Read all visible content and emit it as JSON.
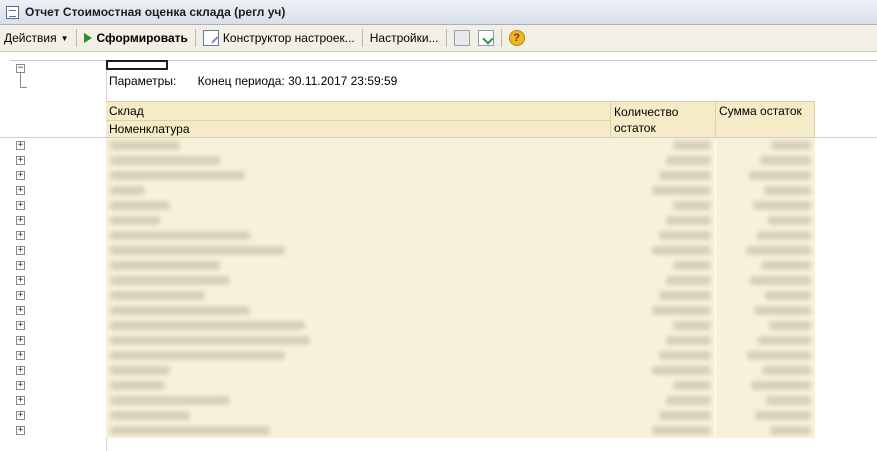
{
  "window": {
    "title": "Отчет  Стоимостная оценка склада (регл уч)"
  },
  "toolbar": {
    "actions_label": "Действия",
    "generate_label": "Сформировать",
    "constructor_label": "Конструктор настроек...",
    "settings_label": "Настройки...",
    "help_label": "?"
  },
  "report": {
    "params_label": "Параметры:",
    "params_value": "Конец периода: 30.11.2017 23:59:59",
    "columns": {
      "warehouse": "Склад",
      "nomenclature": "Номенклатура",
      "quantity": "Количество остаток",
      "sum": "Сумма остаток"
    },
    "row_count": 20
  }
}
